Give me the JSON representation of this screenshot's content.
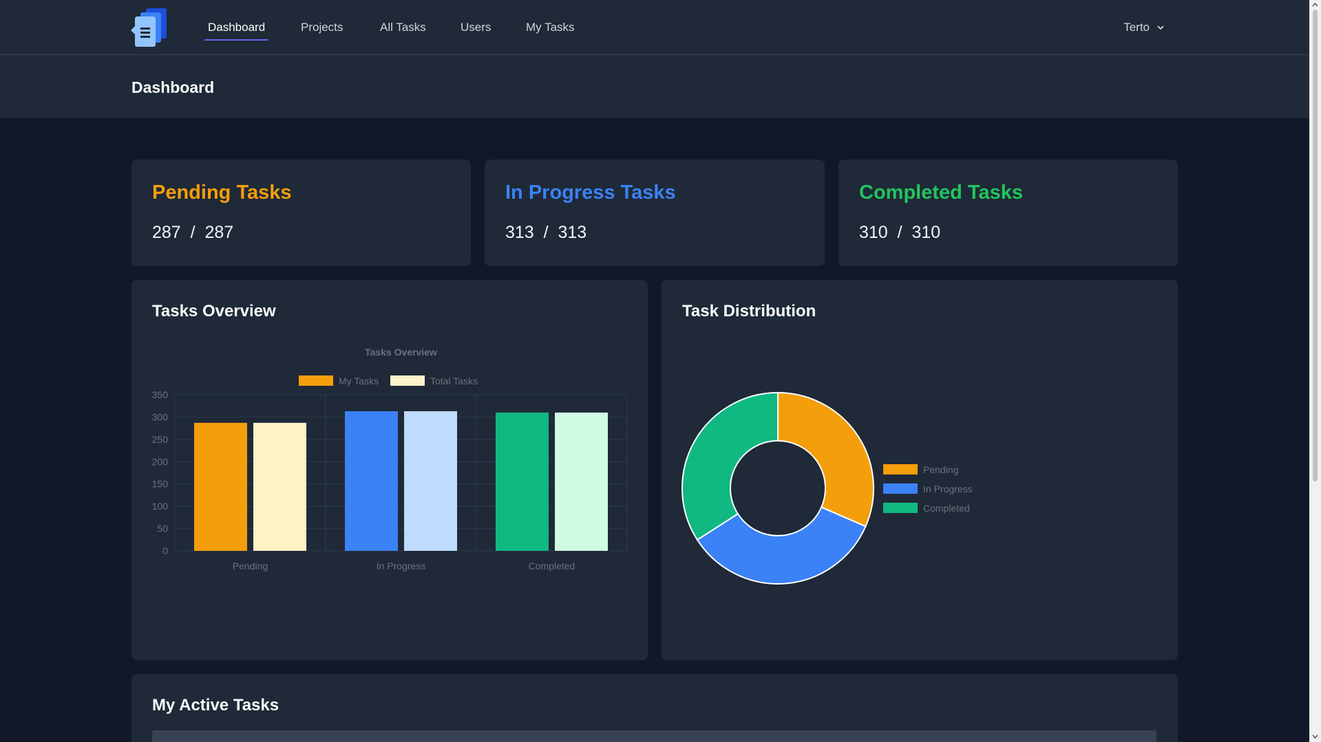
{
  "nav": {
    "links": [
      "Dashboard",
      "Projects",
      "All Tasks",
      "Users",
      "My Tasks"
    ],
    "user": "Terto"
  },
  "page": {
    "title": "Dashboard"
  },
  "stats": [
    {
      "title": "Pending Tasks",
      "value": "287  /  287",
      "color": "#f59e0b"
    },
    {
      "title": "In Progress Tasks",
      "value": "313  /  313",
      "color": "#3b82f6"
    },
    {
      "title": "Completed Tasks",
      "value": "310  /  310",
      "color": "#22c55e"
    }
  ],
  "overview": {
    "card_title": "Tasks Overview"
  },
  "distribution": {
    "card_title": "Task Distribution"
  },
  "active": {
    "card_title": "My Active Tasks"
  },
  "chart_data": [
    {
      "type": "bar",
      "title": "Tasks Overview",
      "categories": [
        "Pending",
        "In Progress",
        "Completed"
      ],
      "series": [
        {
          "name": "My Tasks",
          "values": [
            287,
            313,
            310
          ],
          "colors": [
            "#f59e0b",
            "#3b82f6",
            "#10b981"
          ]
        },
        {
          "name": "Total Tasks",
          "values": [
            287,
            313,
            310
          ],
          "colors": [
            "#fef3c7",
            "#bfdbfe",
            "#d1fae5"
          ]
        }
      ],
      "yticks": [
        "0",
        "50",
        "100",
        "150",
        "200",
        "250",
        "300",
        "350"
      ],
      "ylim": [
        0,
        350
      ],
      "grid": true,
      "legend": "top"
    },
    {
      "type": "pie",
      "labels": [
        "Pending",
        "In Progress",
        "Completed"
      ],
      "values": [
        287,
        313,
        310
      ],
      "colors": [
        "#f59e0b",
        "#3b82f6",
        "#10b981"
      ],
      "donut": true,
      "legend": "right"
    }
  ]
}
